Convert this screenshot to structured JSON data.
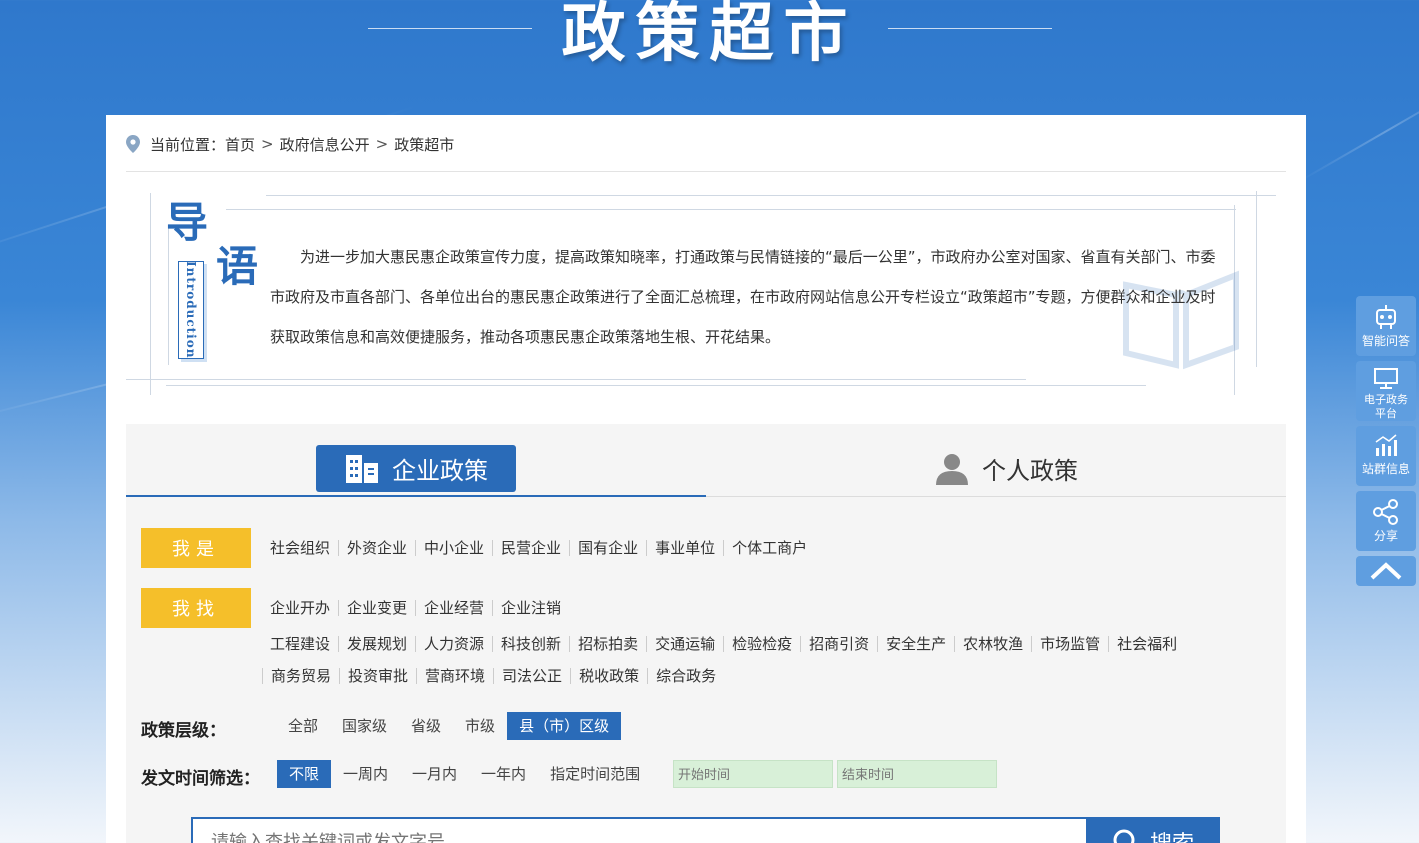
{
  "banner": {
    "title": "政策超市"
  },
  "breadcrumb": {
    "prefix": "当前位置：",
    "items": [
      "首页",
      "政府信息公开",
      "政策超市"
    ],
    "separator": ">"
  },
  "intro": {
    "char1": "导",
    "char2": "语",
    "english": "Introduction",
    "text": "为进一步加大惠民惠企政策宣传力度，提高政策知晓率，打通政策与民情链接的“最后一公里”，市政府办公室对国家、省直有关部门、市委市政府及市直各部门、各单位出台的惠民惠企政策进行了全面汇总梳理，在市政府网站信息公开专栏设立“政策超市”专题，方便群众和企业及时获取政策信息和高效便捷服务，推动各项惠民惠企政策落地生根、开花结果。"
  },
  "tabs": {
    "enterprise": "企业政策",
    "personal": "个人政策"
  },
  "i_am": {
    "label": "我是",
    "options": [
      "社会组织",
      "外资企业",
      "中小企业",
      "民营企业",
      "国有企业",
      "事业单位",
      "个体工商户"
    ]
  },
  "i_find": {
    "label": "我找",
    "row1": [
      "企业开办",
      "企业变更",
      "企业经营",
      "企业注销"
    ],
    "row2": [
      "工程建设",
      "发展规划",
      "人力资源",
      "科技创新",
      "招标拍卖",
      "交通运输",
      "检验检疫",
      "招商引资",
      "安全生产",
      "农林牧渔",
      "市场监管",
      "社会福利"
    ],
    "row3": [
      "商务贸易",
      "投资审批",
      "营商环境",
      "司法公正",
      "税收政策",
      "综合政务"
    ]
  },
  "level": {
    "label": "政策层级：",
    "options": [
      "全部",
      "国家级",
      "省级",
      "市级",
      "县（市）区级"
    ],
    "selected": "县（市）区级"
  },
  "time": {
    "label": "发文时间筛选：",
    "options": [
      "不限",
      "一周内",
      "一月内",
      "一年内",
      "指定时间范围"
    ],
    "selected": "不限",
    "start_placeholder": "开始时间",
    "end_placeholder": "结束时间"
  },
  "search": {
    "placeholder": "请输入查找关键词或发文字号",
    "button": "搜索"
  },
  "sidebar": {
    "items": [
      "智能问答",
      "电子政务平台",
      "站群信息",
      "分享"
    ]
  },
  "colors": {
    "primary": "#2a6bb8",
    "accent": "#f5bf2a",
    "side": "#5f9ee0"
  }
}
